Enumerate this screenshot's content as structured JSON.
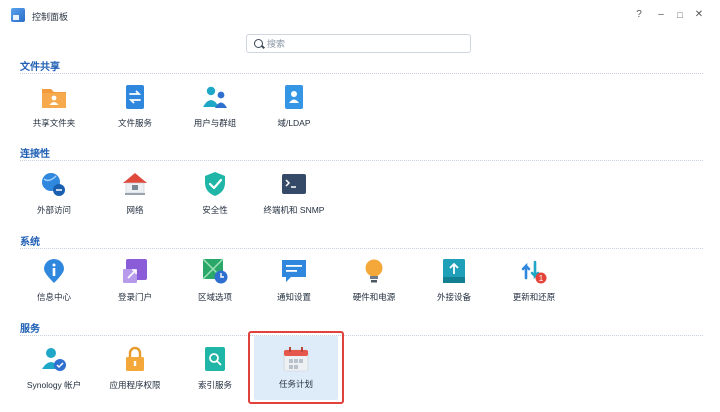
{
  "window": {
    "title": "控制面板"
  },
  "controls": {
    "help": "?",
    "minimize": "–",
    "maximize": "□",
    "close": "✕"
  },
  "search": {
    "placeholder": "搜索"
  },
  "sections": {
    "file_sharing": {
      "title": "文件共享",
      "items": [
        "共享文件夹",
        "文件服务",
        "用户与群组",
        "域/LDAP"
      ]
    },
    "connectivity": {
      "title": "连接性",
      "items": [
        "外部访问",
        "网络",
        "安全性",
        "终端机和 SNMP"
      ]
    },
    "system": {
      "title": "系统",
      "items": [
        "信息中心",
        "登录门户",
        "区域选项",
        "通知设置",
        "硬件和电源",
        "外接设备",
        "更新和还原"
      ]
    },
    "services": {
      "title": "服务",
      "items": [
        "Synology 帐户",
        "应用程序权限",
        "索引服务",
        "任务计划"
      ]
    }
  },
  "badges": {
    "update_count": "1"
  },
  "colors": {
    "section_title": "#1f5fb4",
    "highlight": "#e0413a",
    "selected_bg": "#deebf8"
  }
}
